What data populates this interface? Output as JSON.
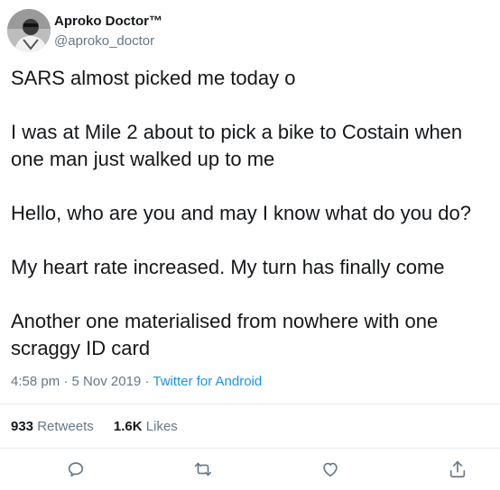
{
  "author": {
    "display_name": "Aproko Doctor™",
    "handle": "@aproko_doctor"
  },
  "tweet": {
    "paragraphs": [
      "SARS almost picked me today o",
      "I was at Mile 2 about to pick a bike to Costain when one man just walked up to me",
      "Hello, who are you and may I know what do you do?",
      "My heart rate increased. My turn has finally come",
      "Another one materialised from nowhere with one scraggy ID card"
    ],
    "time": "4:58 pm",
    "date": "5 Nov 2019",
    "separator": "·",
    "source": "Twitter for Android"
  },
  "stats": {
    "retweets_count": "933",
    "retweets_label": "Retweets",
    "likes_count": "1.6K",
    "likes_label": "Likes"
  },
  "actions": {
    "reply_icon": "reply-icon",
    "retweet_icon": "retweet-icon",
    "like_icon": "heart-icon",
    "share_icon": "share-icon"
  },
  "colors": {
    "link": "#1b95e0",
    "muted": "#657786",
    "text": "#14171a",
    "divider": "#e6ecf0"
  }
}
